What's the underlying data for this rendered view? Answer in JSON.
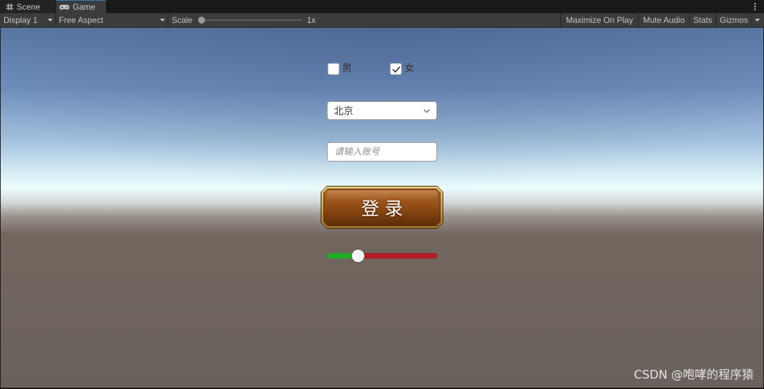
{
  "editor": {
    "tabs": [
      {
        "label": "Scene",
        "icon": "grid-icon",
        "selected": false
      },
      {
        "label": "Game",
        "icon": "gamepad-icon",
        "selected": true
      }
    ],
    "window_menu_icon": "kebab-menu-icon"
  },
  "toolbar": {
    "display": {
      "label": "Display 1",
      "icon": "dropdown-arrow-icon"
    },
    "aspect": {
      "label": "Free Aspect",
      "icon": "dropdown-arrow-icon"
    },
    "scale": {
      "label": "Scale",
      "value_text": "1x",
      "slider_fraction": 0
    },
    "maximize_on_play": "Maximize On Play",
    "mute_audio": "Mute Audio",
    "stats": "Stats",
    "gizmos": "Gizmos",
    "gizmos_menu_icon": "dropdown-arrow-icon"
  },
  "game": {
    "toggles": [
      {
        "label": "男",
        "checked": false
      },
      {
        "label": "女",
        "checked": true
      }
    ],
    "dropdown": {
      "value": "北京",
      "icon": "chevron-down-icon"
    },
    "input": {
      "placeholder": "请输入账号"
    },
    "login_button": {
      "label": "登 录"
    },
    "slider": {
      "value": 0.25
    }
  },
  "watermark": "CSDN @咆哮的程序猿",
  "colors": {
    "selected_tab_accent": "#3a79bb",
    "slider_fill": "#21ad28",
    "slider_background": "#b81e2a"
  }
}
